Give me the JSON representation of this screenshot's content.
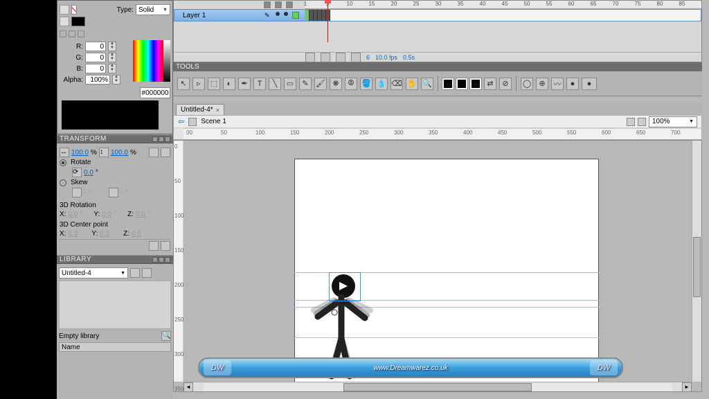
{
  "color_panel": {
    "type_label": "Type:",
    "type_value": "Solid",
    "r_label": "R:",
    "r": "0",
    "g_label": "G:",
    "g": "0",
    "b_label": "B:",
    "b": "0",
    "alpha_label": "Alpha:",
    "alpha": "100%",
    "hex": "#000000"
  },
  "transform": {
    "title": "TRANSFORM",
    "scale_w": "100.0",
    "scale_w_unit": "%",
    "scale_h": "100.0",
    "scale_h_unit": "%",
    "rotate_label": "Rotate",
    "rotate_val": "0.0",
    "rotate_unit": "°",
    "skew_label": "Skew",
    "skew_a": "-",
    "skew_a_unit": "°",
    "skew_b": "-",
    "skew_b_unit": "°",
    "rot3d_label": "3D Rotation",
    "x_label": "X:",
    "x3": "0.0",
    "x3_unit": "°",
    "y_label": "Y:",
    "y3": "0.0",
    "y3_unit": "°",
    "z_label": "Z:",
    "z3": "0.0",
    "z3_unit": "°",
    "center3d_label": "3D Center point",
    "xc": "0.0",
    "yc": "0.0",
    "zc": "0.0"
  },
  "library": {
    "title": "LIBRARY",
    "doc": "Untitled-4",
    "empty": "Empty library",
    "col_name": "Name"
  },
  "timeline": {
    "layer": "Layer 1",
    "marks": [
      "1",
      "5",
      "10",
      "15",
      "20",
      "25",
      "30",
      "35",
      "40",
      "45",
      "50",
      "55",
      "60",
      "65",
      "70",
      "75",
      "80",
      "85"
    ],
    "cur_frame": "6",
    "fps": "10.0 fps",
    "time": "0.5s"
  },
  "tools": {
    "title": "TOOLS"
  },
  "doc": {
    "tab": "Untitled-4*"
  },
  "scene": {
    "name": "Scene 1",
    "zoom": "100%"
  },
  "hruler": [
    "00",
    "50",
    "100",
    "150",
    "200",
    "250",
    "300",
    "350",
    "400",
    "450",
    "500",
    "550",
    "600",
    "650",
    "700"
  ],
  "vruler": [
    "0",
    "50",
    "100",
    "150",
    "200",
    "250",
    "300",
    "350"
  ],
  "banner": {
    "text": "www.Dreamwarez.co.uk",
    "badge": "DW"
  }
}
